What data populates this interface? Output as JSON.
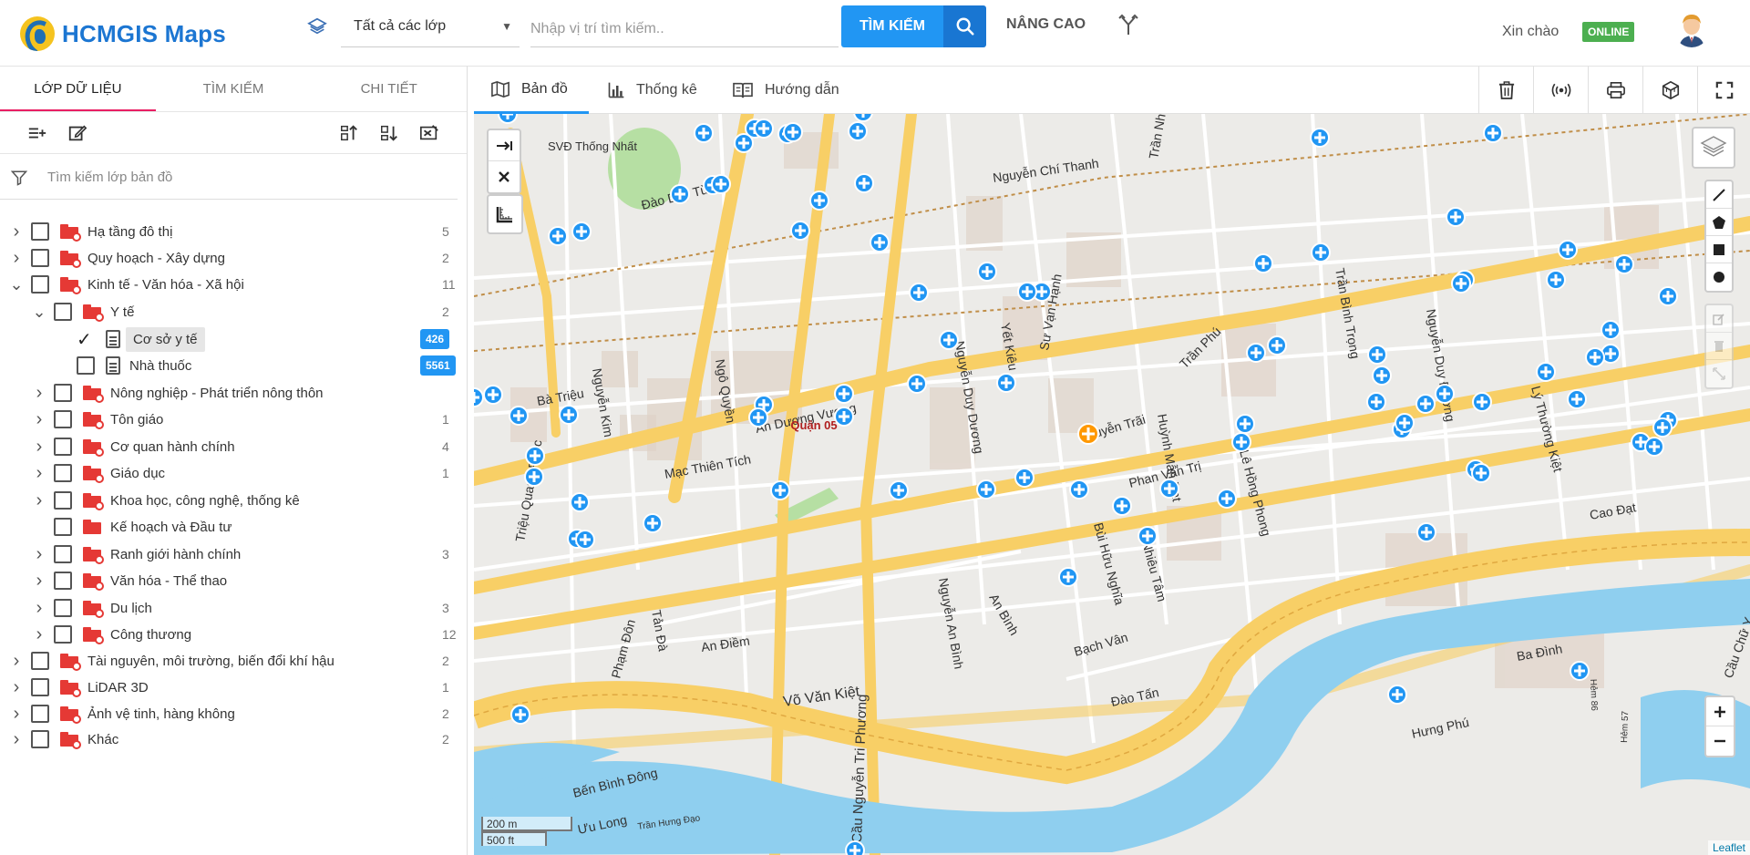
{
  "header": {
    "app_title": "HCMGIS Maps",
    "layer_select_value": "Tất cả các lớp",
    "search_placeholder": "Nhập vị trí tìm kiếm..",
    "search_button": "TÌM KIẾM",
    "advanced_label": "NÂNG CAO",
    "greeting": "Xin chào",
    "status_badge": "ONLINE",
    "colors": {
      "brand": "#1c76d2",
      "primary": "#2196f3",
      "online": "#4caf50"
    }
  },
  "left_panel": {
    "tabs": [
      {
        "label": "LỚP DỮ LIỆU",
        "active": true
      },
      {
        "label": "TÌM KIẾM",
        "active": false
      },
      {
        "label": "CHI TIẾT",
        "active": false
      }
    ],
    "filter_placeholder": "Tìm kiếm lớp bản đồ",
    "tree": [
      {
        "label": "Hạ tầng đô thị",
        "count": "5",
        "icon": "folder-icon",
        "expanded": false
      },
      {
        "label": "Quy hoạch - Xây dựng",
        "count": "2",
        "icon": "folder-icon",
        "expanded": false
      },
      {
        "label": "Kinh tế - Văn hóa - Xã hội",
        "count": "11",
        "icon": "folder-icon",
        "expanded": true
      },
      {
        "label": "Y tế",
        "count": "2",
        "icon": "folder-icon",
        "expanded": true
      },
      {
        "label": "Cơ sở y tế",
        "count": "426",
        "icon": "document-icon",
        "checked": true
      },
      {
        "label": "Nhà thuốc",
        "count": "5561",
        "icon": "document-icon",
        "checked": false
      },
      {
        "label": "Nông nghiệp - Phát triển nông thôn",
        "count": "",
        "icon": "folder-icon"
      },
      {
        "label": "Tôn giáo",
        "count": "1",
        "icon": "folder-icon"
      },
      {
        "label": "Cơ quan hành chính",
        "count": "4",
        "icon": "folder-icon"
      },
      {
        "label": "Giáo dục",
        "count": "1",
        "icon": "folder-icon"
      },
      {
        "label": "Khoa học, công nghệ, thống kê",
        "count": "",
        "icon": "folder-icon"
      },
      {
        "label": "Kế hoạch và Đầu tư",
        "count": "",
        "icon": "folder-icon"
      },
      {
        "label": "Ranh giới hành chính",
        "count": "3",
        "icon": "folder-icon"
      },
      {
        "label": "Văn hóa - Thể thao",
        "count": "",
        "icon": "folder-icon"
      },
      {
        "label": "Du lịch",
        "count": "3",
        "icon": "folder-icon"
      },
      {
        "label": "Công thương",
        "count": "12",
        "icon": "folder-icon"
      },
      {
        "label": "Tài nguyên, môi trường, biến đổi khí hậu",
        "count": "2",
        "icon": "folder-icon"
      },
      {
        "label": "LiDAR 3D",
        "count": "1",
        "icon": "folder-icon"
      },
      {
        "label": "Ảnh vệ tinh, hàng không",
        "count": "2",
        "icon": "folder-icon"
      },
      {
        "label": "Khác",
        "count": "2",
        "icon": "folder-icon"
      }
    ]
  },
  "map_tabs": [
    {
      "label": "Bản đồ",
      "icon": "map-icon",
      "active": true
    },
    {
      "label": "Thống kê",
      "icon": "bar-chart-icon",
      "active": false
    },
    {
      "label": "Hướng dẫn",
      "icon": "book-icon",
      "active": false
    }
  ],
  "map": {
    "district_label": "Quận 05",
    "street_labels": [
      "SVĐ Thống Nhất",
      "Nguyễn Chí Thanh",
      "Trần Nhân Tôn",
      "Đào Duy Từ",
      "Ngô Quyền",
      "Nguyễn Kim",
      "Bà Triệu",
      "An Dương Vương",
      "Nguyễn Duy Dương",
      "Sư Vạn Hạnh",
      "Yết Kiêu",
      "Trần Phú",
      "Trần Bình Trọng",
      "Lê Hồng Phong",
      "Mạc Thiên Tích",
      "Nguyễn Trãi",
      "Phan Văn Trị",
      "Huỳnh Mẫn Đạt",
      "Cao Đạt",
      "Bùi Hữu Nghĩa",
      "Nhiêu Tâm",
      "Triệu Quang Phục",
      "Tản Đà",
      "Phạm Đôn",
      "An Điềm",
      "Nguyễn An Bình",
      "An Bình",
      "Bạch Vân",
      "Đào Tấn",
      "Ba Đình",
      "Hưng Phú",
      "Võ Văn Kiệt",
      "Cầu Nguyễn Tri Phương",
      "Bến Bình Đông",
      "Ưu Long",
      "Hẻm 86",
      "Hẻm 57",
      "Cầu Chữ Y",
      "Lý Thường Kiệt",
      "Nguyễn Duy Đương",
      "Trần Hưng Đạo"
    ],
    "scale_metric": "200 m",
    "scale_imperial": "500 ft",
    "attribution": "Leaflet",
    "marker_color": "#2196f3",
    "poi_color": "#ff9800"
  }
}
